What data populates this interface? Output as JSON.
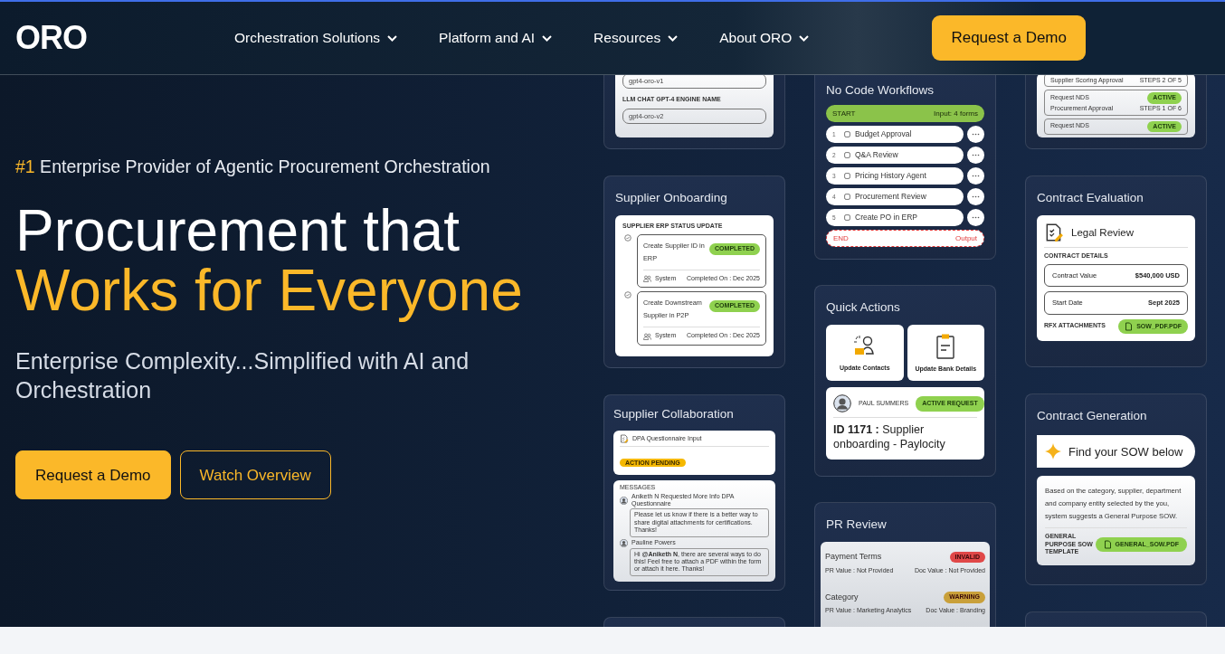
{
  "navbar": {
    "logo": "ORO",
    "menu": [
      {
        "label": "Orchestration Solutions"
      },
      {
        "label": "Platform and AI"
      },
      {
        "label": "Resources"
      },
      {
        "label": "About ORO"
      }
    ],
    "cta": "Request a Demo"
  },
  "hero": {
    "tagline": {
      "rank": "#1",
      "text": "Enterprise Provider of Agentic Procurement Orchestration"
    },
    "headline": "Procurement that",
    "headline_accent": "Works for Everyone",
    "subtitle": "Enterprise Complexity...Simplified with AI and Orchestration",
    "buttons": [
      {
        "label": "Request a Demo",
        "kind": "primary"
      },
      {
        "label": "Watch Overview",
        "kind": "outline"
      }
    ]
  },
  "showcase": {
    "columns": [
      [
        {
          "kind": "fields",
          "items": [
            {
              "kind": "field",
              "text": "gpt4-oro-v1"
            },
            {
              "kind": "label",
              "text": "LLM CHAT GPT-4 ENGINE NAME"
            },
            {
              "kind": "field",
              "text": "gpt4-oro-v2"
            }
          ]
        },
        {
          "kind": "timeline",
          "title": "Supplier Onboarding",
          "heading": "SUPPLIER ERP STATUS UPDATE",
          "steps": [
            {
              "name": "Create Supplier ID in ERP",
              "status": "COMPLETED",
              "actor": "System",
              "date": "Completed On : Dec 2025"
            },
            {
              "name": "Create Downstream Supplier in P2P",
              "status": "COMPLETED",
              "actor": "System",
              "date": "Completed On : Dec 2025"
            }
          ]
        },
        {
          "kind": "collaboration",
          "title": "Supplier Collaboration",
          "task": "DPA Questionnaire Input",
          "task_status": "ACTION PENDING",
          "messages_label": "MESSAGES",
          "messages": [
            {
              "author": "Aniketh N Requested More Info DPA Questionnaire",
              "text": "Please let us know if there is a better way to share digital attachments for certifications. Thanks!"
            },
            {
              "author": "Pauline Powers",
              "text": "Hi **@Aniketh N**, there are several ways to do this! Feel free to attach a PDF within the form or attach it here. Thanks!"
            }
          ]
        },
        {
          "kind": "stub"
        }
      ],
      [
        {
          "kind": "workflow",
          "title": "No Code Workflows",
          "start": {
            "label": "START",
            "note": "Input: 4 forms"
          },
          "steps": [
            {
              "number": "1",
              "label": "Budget Approval"
            },
            {
              "number": "2",
              "label": "Q&A Review"
            },
            {
              "number": "3",
              "label": "Pricing History Agent"
            },
            {
              "number": "4",
              "label": "Procurement Review"
            },
            {
              "number": "5",
              "label": "Create PO in ERP"
            }
          ],
          "end": {
            "label": "END",
            "note": "Output"
          }
        },
        {
          "kind": "quick_actions",
          "title": "Quick Actions",
          "actions": [
            "Update Contacts",
            "Update Bank Details"
          ],
          "request": {
            "person": "PAUL SUMMERS",
            "status": "ACTIVE REQUEST",
            "text": "**ID 1171 :** Supplier onboarding - Paylocity"
          }
        },
        {
          "kind": "pr_review",
          "title": "PR Review",
          "checks": [
            {
              "name": "Payment Terms",
              "status": "INVALID",
              "color": "#e04848",
              "pr": "PR Value : Not Provided",
              "doc": "Doc Value : Not Provided"
            },
            {
              "name": "Category",
              "status": "WARNING",
              "color": "#c9a03a",
              "pr": "PR Value : Marketing Analytics",
              "doc": "Doc Value : Branding"
            }
          ]
        }
      ],
      [
        {
          "kind": "nda_list",
          "rows": [
            {
              "sub": "Supplier Scoring Approval",
              "steps": "STEPS 2 OF 5"
            },
            {
              "name": "Request NDS",
              "status": "ACTIVE",
              "sub": "Procurement Approval",
              "steps": "STEPS 1 OF 6"
            },
            {
              "name": "Request NDS",
              "status": "ACTIVE"
            }
          ]
        },
        {
          "kind": "contract_eval",
          "title": "Contract Evaluation",
          "doc": "Legal Review",
          "details_label": "CONTRACT DETAILS",
          "details": [
            {
              "label": "Contract Value",
              "value": "$540,000 USD"
            },
            {
              "label": "Start Date",
              "value": "Sept 2025"
            }
          ],
          "attachments_label": "RFX ATTACHMENTS",
          "attachment": "SOW_PDF.PDF"
        },
        {
          "kind": "contract_gen",
          "title": "Contract Generation",
          "prompt": "Find your SOW below",
          "text": "Based on the category, supplier, department and company entity selected by the you, system suggests a General Purpose SOW.",
          "template_label": "GENERAL PURPOSE SOW TEMPLATE",
          "file": "GENERAL_SOW.PDF"
        },
        {
          "kind": "stub"
        }
      ]
    ]
  }
}
